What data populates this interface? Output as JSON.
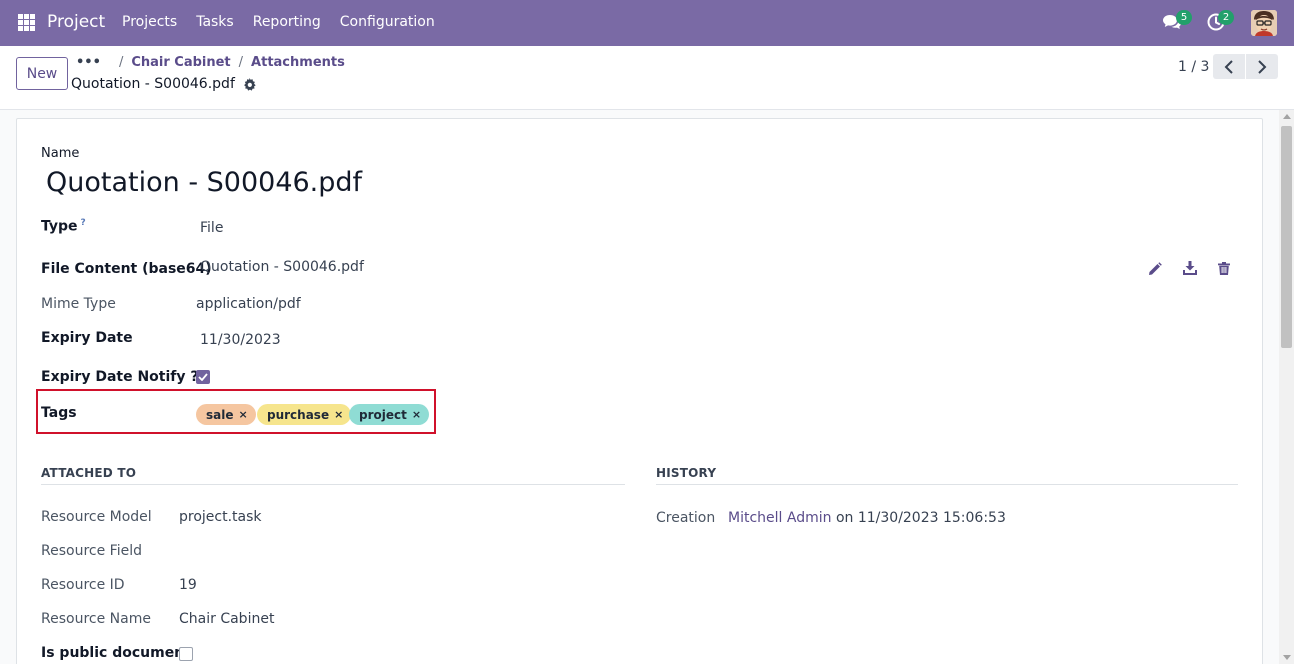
{
  "navbar": {
    "app_name": "Project",
    "menu": [
      "Projects",
      "Tasks",
      "Reporting",
      "Configuration"
    ],
    "messages_count": "5",
    "activities_count": "2",
    "accent_color": "#7a6aa5"
  },
  "control_panel": {
    "new_label": "New",
    "breadcrumb_more": "•••",
    "breadcrumbs": [
      "Chair Cabinet",
      "Attachments"
    ],
    "record_title": "Quotation - S00046.pdf",
    "pager": "1 / 3"
  },
  "form": {
    "name_label": "Name",
    "name_value": "Quotation - S00046.pdf",
    "type_label": "Type",
    "type_help": "?",
    "type_value": "File",
    "file_content_label": "File Content (base64)",
    "file_content_value": "Quotation - S00046.pdf",
    "mime_label": "Mime Type",
    "mime_value": "application/pdf",
    "expiry_label": "Expiry Date",
    "expiry_value": "11/30/2023",
    "expiry_notify_label": "Expiry Date Notify ??",
    "expiry_notify_checked": true,
    "tags_label": "Tags",
    "tags": [
      {
        "label": "sale",
        "color": "#f5c6a0"
      },
      {
        "label": "purchase",
        "color": "#f6e58d"
      },
      {
        "label": "project",
        "color": "#8fdcd4"
      }
    ],
    "tag_remove_glyph": "×"
  },
  "attached_to": {
    "title": "ATTACHED TO",
    "resource_model_label": "Resource Model",
    "resource_model_value": "project.task",
    "resource_field_label": "Resource Field",
    "resource_field_value": "",
    "resource_id_label": "Resource ID",
    "resource_id_value": "19",
    "resource_name_label": "Resource Name",
    "resource_name_value": "Chair Cabinet",
    "is_public_label": "Is public document",
    "is_public_checked": false
  },
  "history": {
    "title": "HISTORY",
    "creation_label": "Creation",
    "creation_user": "Mitchell Admin",
    "creation_on": "on 11/30/2023 15:06:53"
  }
}
